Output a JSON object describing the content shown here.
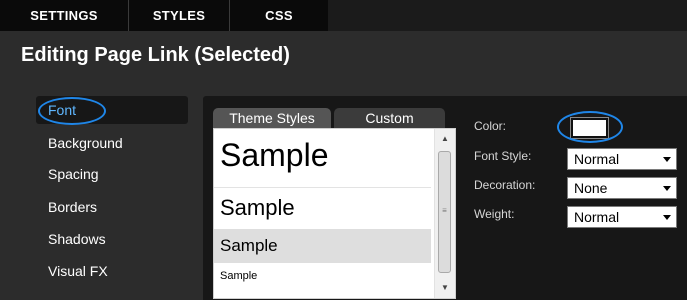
{
  "top_tabs": [
    {
      "label": "SETTINGS"
    },
    {
      "label": "STYLES"
    },
    {
      "label": "CSS"
    }
  ],
  "heading": "Editing Page Link (Selected)",
  "sidebar": {
    "items": [
      {
        "label": "Font",
        "active": true
      },
      {
        "label": "Background"
      },
      {
        "label": "Spacing"
      },
      {
        "label": "Borders"
      },
      {
        "label": "Shadows"
      },
      {
        "label": "Visual FX"
      }
    ]
  },
  "panel_tabs": [
    {
      "label": "Theme Styles",
      "active": true
    },
    {
      "label": "Custom"
    }
  ],
  "samples": [
    {
      "label": "Sample"
    },
    {
      "label": "Sample"
    },
    {
      "label": "Sample",
      "selected": true
    },
    {
      "label": "Sample"
    }
  ],
  "properties": {
    "color": {
      "label": "Color:",
      "value": "#ffffff"
    },
    "font_style": {
      "label": "Font Style:",
      "value": "Normal"
    },
    "decoration": {
      "label": "Decoration:",
      "value": "None"
    },
    "weight": {
      "label": "Weight:",
      "value": "Normal"
    }
  },
  "icons": {
    "scroll_up": "scroll-up-arrow-icon",
    "scroll_down": "scroll-down-arrow-icon",
    "dropdown": "chevron-down-icon"
  },
  "colors": {
    "accent_highlight": "#1f86e8",
    "active_sidebar_text": "#5fb7ff"
  }
}
